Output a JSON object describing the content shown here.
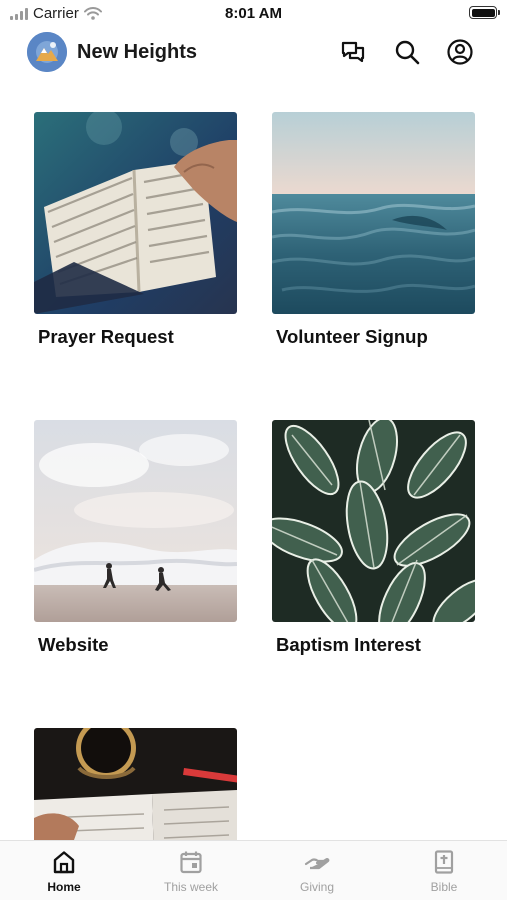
{
  "status_bar": {
    "carrier": "Carrier",
    "time": "8:01 AM"
  },
  "header": {
    "title": "New Heights",
    "icons": [
      "chat-icon",
      "search-icon",
      "profile-icon"
    ]
  },
  "tiles": [
    {
      "label": "Prayer Request",
      "image": "open-bible-photo"
    },
    {
      "label": "Volunteer Signup",
      "image": "ocean-waves-photo"
    },
    {
      "label": "Website",
      "image": "beach-runners-photo"
    },
    {
      "label": "Baptism Interest",
      "image": "leaves-photo"
    },
    {
      "label": "",
      "image": "coffee-journal-photo"
    }
  ],
  "tab_bar": {
    "items": [
      {
        "label": "Home",
        "icon": "home-icon",
        "active": true
      },
      {
        "label": "This week",
        "icon": "calendar-icon",
        "active": false
      },
      {
        "label": "Giving",
        "icon": "giving-hand-icon",
        "active": false
      },
      {
        "label": "Bible",
        "icon": "bible-icon",
        "active": false
      }
    ]
  },
  "colors": {
    "accent": "#5a86c5",
    "active_tab": "#111111",
    "inactive_tab": "#a0a0a0"
  }
}
